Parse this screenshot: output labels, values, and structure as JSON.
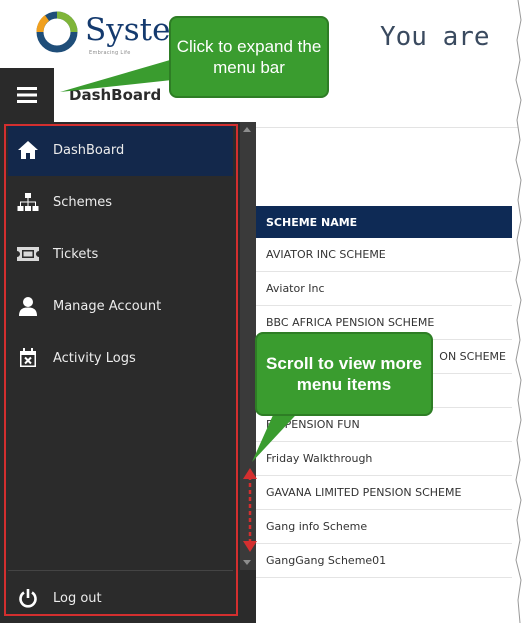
{
  "header": {
    "logo_text": "Systec",
    "logo_tagline": "Embracing Life",
    "welcome_text": "You are"
  },
  "topbar": {
    "menu_icon": "hamburger-menu-icon",
    "page_title": "DashBoard"
  },
  "sidebar": {
    "items": [
      {
        "label": "DashBoard",
        "icon": "home-icon",
        "active": true
      },
      {
        "label": "Schemes",
        "icon": "sitemap-icon",
        "active": false
      },
      {
        "label": "Tickets",
        "icon": "ticket-icon",
        "active": false
      },
      {
        "label": "Manage Account",
        "icon": "user-icon",
        "active": false
      },
      {
        "label": "Activity Logs",
        "icon": "calendar-x-icon",
        "active": false
      }
    ],
    "logout_label": "Log out",
    "logout_icon": "power-icon"
  },
  "table": {
    "header": "SCHEME NAME",
    "rows": [
      "AVIATOR INC SCHEME",
      "Aviator Inc",
      "BBC AFRICA PENSION SCHEME",
      "ON SCHEME",
      "",
      "EN  PENSION FUN",
      "Friday Walkthrough",
      "GAVANA LIMITED PENSION SCHEME",
      "Gang info Scheme",
      "GangGang Scheme01"
    ]
  },
  "callouts": {
    "expand": "Click to expand the menu bar",
    "scroll": "Scroll to view more menu items"
  },
  "colors": {
    "sidebar_bg": "#2b2b2b",
    "active_item": "#13284b",
    "table_header": "#0e2a55",
    "callout": "#3a9c2f",
    "highlight": "#d32f2f"
  }
}
